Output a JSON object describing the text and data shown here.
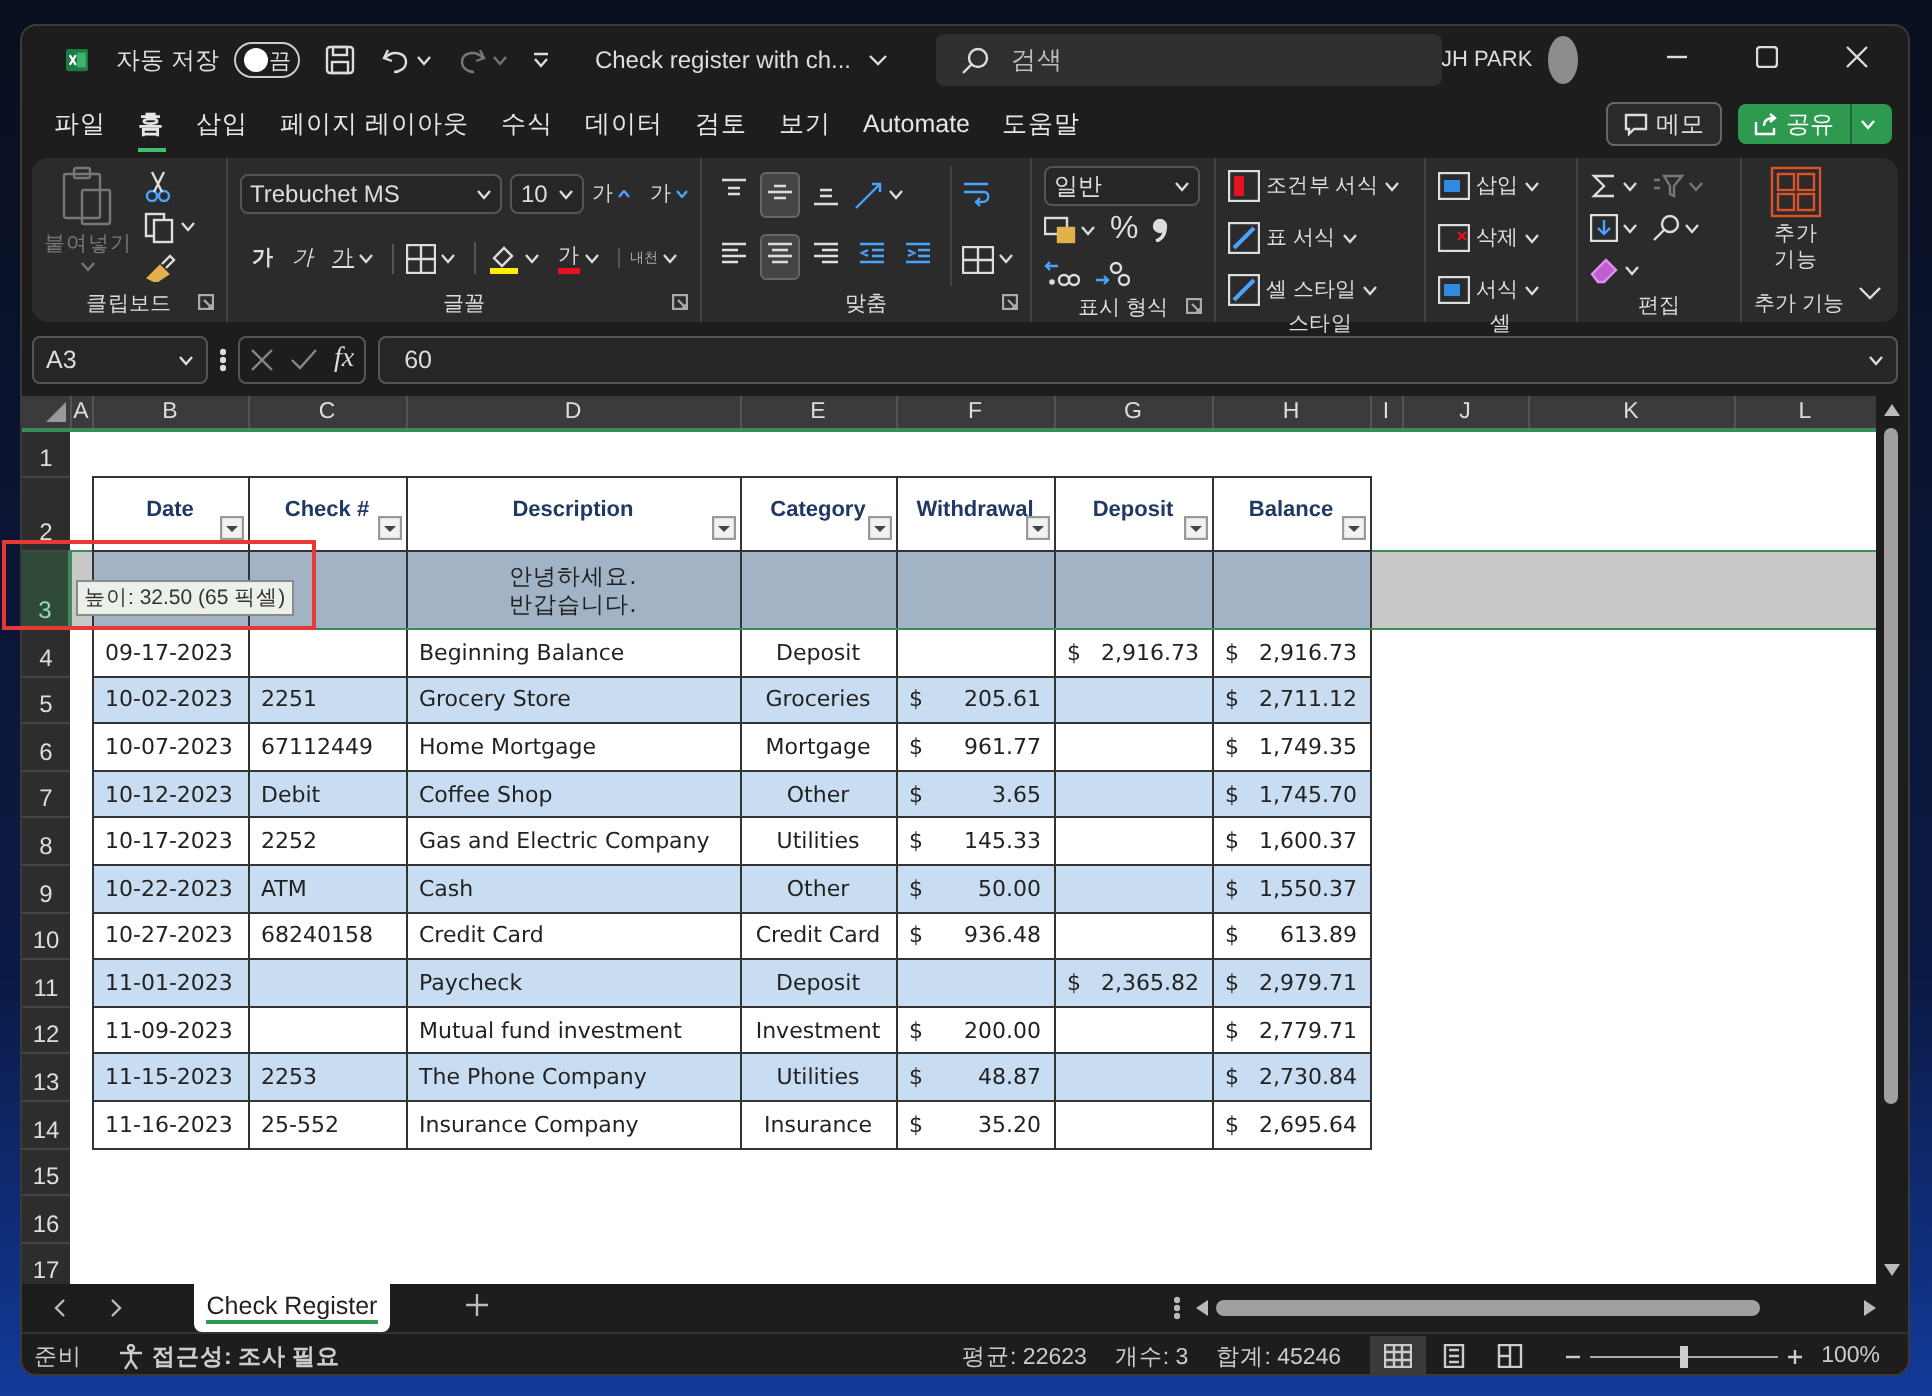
{
  "title_bar": {
    "autosave": {
      "label": "자동 저장",
      "state_text": "끔",
      "on": false
    },
    "file_name": "Check register with ch...",
    "search": {
      "placeholder": "검색"
    },
    "user": "JH PARK"
  },
  "menu": {
    "tabs": [
      {
        "label": "파일",
        "selected": false
      },
      {
        "label": "홈",
        "selected": true
      },
      {
        "label": "삽입",
        "selected": false
      },
      {
        "label": "페이지 레이아웃",
        "selected": false
      },
      {
        "label": "수식",
        "selected": false
      },
      {
        "label": "데이터",
        "selected": false
      },
      {
        "label": "검토",
        "selected": false
      },
      {
        "label": "보기",
        "selected": false
      },
      {
        "label": "Automate",
        "selected": false
      },
      {
        "label": "도움말",
        "selected": false
      }
    ],
    "memo": "메모",
    "share": "공유"
  },
  "ribbon": {
    "groups": [
      {
        "kind": "clipboard",
        "label": "클립보드",
        "paste": "붙여넣기",
        "paste_disabled": true
      },
      {
        "kind": "font",
        "label": "글꼴",
        "font_name": "Trebuchet MS",
        "font_size": "10",
        "grow": "가",
        "shrink": "가",
        "bold": "가",
        "italic": "가",
        "underline": "가",
        "font_color": "가",
        "phonetic": "내천"
      },
      {
        "kind": "alignment",
        "label": "맞춤",
        "vertical": [
          {
            "kind": "top",
            "selected": false
          },
          {
            "kind": "middle",
            "selected": true
          },
          {
            "kind": "bottom",
            "selected": false
          }
        ],
        "horizontal": [
          {
            "kind": "left",
            "selected": false
          },
          {
            "kind": "center",
            "selected": true
          },
          {
            "kind": "right",
            "selected": false
          }
        ]
      },
      {
        "kind": "number",
        "label": "표시 형식",
        "format": "일반",
        "percent": "%"
      },
      {
        "kind": "styles",
        "label": "스타일",
        "items": [
          "조건부 서식",
          "표 서식",
          "셀 스타일"
        ]
      },
      {
        "kind": "cells",
        "label": "셀",
        "items": [
          "삽입",
          "삭제",
          "서식"
        ]
      },
      {
        "kind": "editing",
        "label": "편집"
      },
      {
        "kind": "addins",
        "label": "추가 기능",
        "button": "추가\n기능"
      }
    ]
  },
  "formula_bar": {
    "name_box": "A3",
    "function_glyph": "fx",
    "formula": "60"
  },
  "sheet": {
    "column_letters": [
      "A",
      "B",
      "C",
      "D",
      "E",
      "F",
      "G",
      "H",
      "I",
      "J",
      "K",
      "L"
    ],
    "columns": [
      {
        "label": "Date",
        "kind": "text"
      },
      {
        "label": "Check #",
        "kind": "text"
      },
      {
        "label": "Description",
        "kind": "text"
      },
      {
        "label": "Category",
        "kind": "center"
      },
      {
        "label": "Withdrawal",
        "kind": "currency"
      },
      {
        "label": "Deposit",
        "kind": "currency"
      },
      {
        "label": "Balance",
        "kind": "currency"
      }
    ],
    "rows": [
      {
        "number": "1",
        "selected": false,
        "kind": "blank"
      },
      {
        "number": "2",
        "selected": false,
        "kind": "header"
      },
      {
        "number": "3",
        "selected": true,
        "kind": "note",
        "shaded": false,
        "cells": [
          null,
          null,
          "안녕하세요.\n반갑습니다.",
          null,
          null,
          null,
          null
        ]
      },
      {
        "number": "4",
        "selected": false,
        "kind": "data",
        "shaded": false,
        "cells": [
          "09-17-2023",
          null,
          "Beginning Balance",
          "Deposit",
          null,
          "$ 2,916.73",
          "$ 2,916.73"
        ]
      },
      {
        "number": "5",
        "selected": false,
        "kind": "data",
        "shaded": true,
        "cells": [
          "10-02-2023",
          "2251",
          "Grocery Store",
          "Groceries",
          "$ 205.61",
          null,
          "$ 2,711.12"
        ]
      },
      {
        "number": "6",
        "selected": false,
        "kind": "data",
        "shaded": false,
        "cells": [
          "10-07-2023",
          "67112449",
          "Home Mortgage",
          "Mortgage",
          "$ 961.77",
          null,
          "$ 1,749.35"
        ]
      },
      {
        "number": "7",
        "selected": false,
        "kind": "data",
        "shaded": true,
        "cells": [
          "10-12-2023",
          "Debit",
          "Coffee Shop",
          "Other",
          "$ 3.65",
          null,
          "$ 1,745.70"
        ]
      },
      {
        "number": "8",
        "selected": false,
        "kind": "data",
        "shaded": false,
        "cells": [
          "10-17-2023",
          "2252",
          "Gas and Electric Company",
          "Utilities",
          "$ 145.33",
          null,
          "$ 1,600.37"
        ]
      },
      {
        "number": "9",
        "selected": false,
        "kind": "data",
        "shaded": true,
        "cells": [
          "10-22-2023",
          "ATM",
          "Cash",
          "Other",
          "$ 50.00",
          null,
          "$ 1,550.37"
        ]
      },
      {
        "number": "10",
        "selected": false,
        "kind": "data",
        "shaded": false,
        "cells": [
          "10-27-2023",
          "68240158",
          "Credit Card",
          "Credit Card",
          "$ 936.48",
          null,
          "$ 613.89"
        ]
      },
      {
        "number": "11",
        "selected": false,
        "kind": "data",
        "shaded": true,
        "cells": [
          "11-01-2023",
          null,
          "Paycheck",
          "Deposit",
          null,
          "$ 2,365.82",
          "$ 2,979.71"
        ]
      },
      {
        "number": "12",
        "selected": false,
        "kind": "data",
        "shaded": false,
        "cells": [
          "11-09-2023",
          null,
          "Mutual fund investment",
          "Investment",
          "$ 200.00",
          null,
          "$ 2,779.71"
        ]
      },
      {
        "number": "13",
        "selected": false,
        "kind": "data",
        "shaded": true,
        "cells": [
          "11-15-2023",
          "2253",
          "The Phone Company",
          "Utilities",
          "$ 48.87",
          null,
          "$ 2,730.84"
        ]
      },
      {
        "number": "14",
        "selected": false,
        "kind": "data",
        "shaded": false,
        "cells": [
          "11-16-2023",
          "25-552",
          "Insurance Company",
          "Insurance",
          "$ 35.20",
          null,
          "$ 2,695.64"
        ]
      },
      {
        "number": "15",
        "selected": false,
        "kind": "blank"
      },
      {
        "number": "16",
        "selected": false,
        "kind": "blank"
      },
      {
        "number": "17",
        "selected": false,
        "kind": "blank"
      }
    ],
    "row_height_tip": "높이: 32.50 (65 픽셀)"
  },
  "sheet_tabs": [
    {
      "label": "Check Register",
      "selected": true
    }
  ],
  "status_bar": {
    "mode": "준비",
    "accessibility": "접근성: 조사 필요",
    "stats": [
      "평균: 22623",
      "개수: 3",
      "합계: 45246"
    ],
    "views": [
      {
        "kind": "normal",
        "selected": true
      },
      {
        "kind": "page_layout",
        "selected": false
      },
      {
        "kind": "page_break",
        "selected": false
      }
    ],
    "zoom": {
      "level": 0.5,
      "label": "100%"
    }
  }
}
